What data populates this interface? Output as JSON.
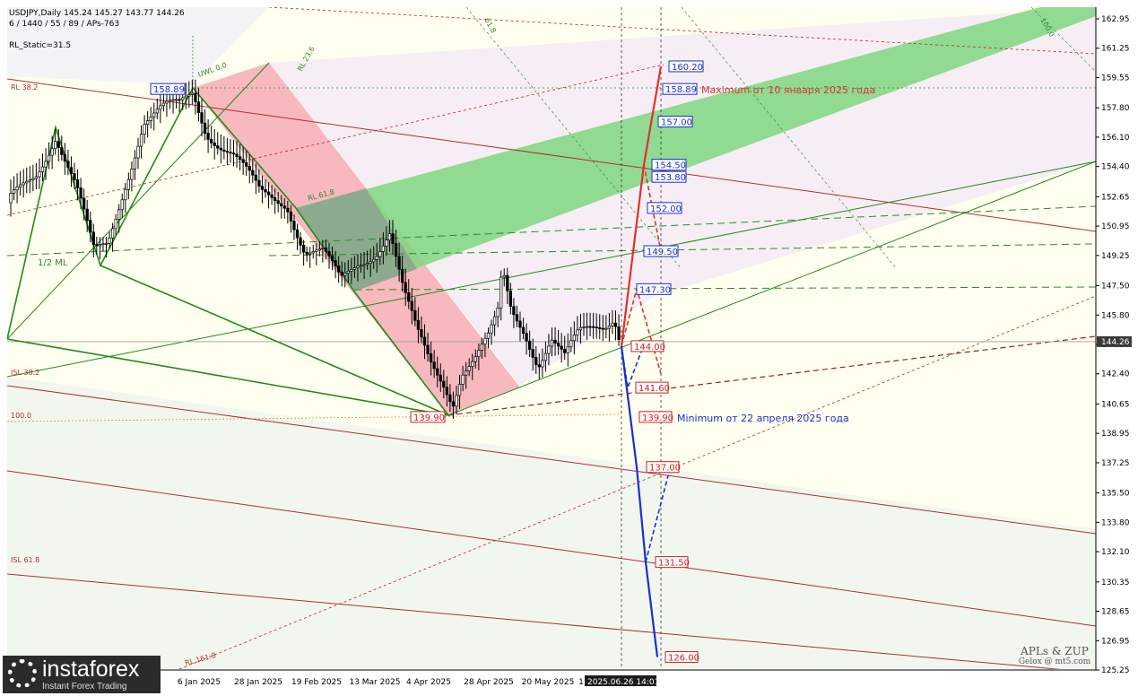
{
  "header": {
    "line1": "USDJPY,Daily  145.24 145.27 143.77 144.26",
    "line2": "6 / 1440 / 55 / 89 / APs-763",
    "indicator": "RL_Static=31.5"
  },
  "annotations": {
    "max_text": "Maximum от 10 января 2025 года",
    "min_text": "Minimum от 22 апреля 2025 года",
    "half_ml": "1/2 ML",
    "time_label": "2025.06.26 14:01",
    "current_price": "144.26"
  },
  "brand": {
    "line1": "APLs & ZUP",
    "line2": "Gelox @ mt5.com"
  },
  "logo": {
    "name": "instaforex",
    "tagline": "Instant Forex Trading"
  },
  "fib_labels": [
    "RL 38.2",
    "RL 23.6",
    "RL 61.8",
    "100.0",
    "61.8",
    "ISL 38.2",
    "ISL 61.8",
    "RL 161.8",
    "100.0",
    "UWL 0.0"
  ],
  "colors": {
    "up_arrow": "#e03030",
    "down_arrow": "#1a2fd0",
    "channel_green": "#7fd67f",
    "pink_zone": "#f4a0ad"
  },
  "chart_data": {
    "type": "candlestick",
    "symbol": "USDJPY",
    "timeframe": "Daily",
    "ylim": [
      125.25,
      163.5
    ],
    "y_ticks": [
      162.95,
      161.25,
      159.55,
      157.8,
      156.1,
      154.4,
      152.65,
      150.95,
      149.25,
      147.5,
      145.8,
      144.1,
      142.4,
      140.65,
      138.95,
      137.25,
      135.5,
      133.8,
      132.1,
      130.35,
      128.65,
      126.95,
      125.25
    ],
    "x_ticks": [
      "24",
      "6 Jan 2025",
      "28 Jan 2025",
      "19 Feb 2025",
      "13 Mar 2025",
      "4 Apr 2025",
      "28 Apr 2025",
      "20 May 2025",
      "1"
    ],
    "extremes": {
      "high": 158.89,
      "low": 139.9
    },
    "target_levels_up": [
      147.3,
      149.5,
      152.0,
      153.8,
      154.5,
      157.0,
      158.89,
      160.2
    ],
    "target_levels_down": [
      144.0,
      141.6,
      139.9,
      137.0,
      131.5,
      126.0
    ],
    "close": 144.26
  }
}
